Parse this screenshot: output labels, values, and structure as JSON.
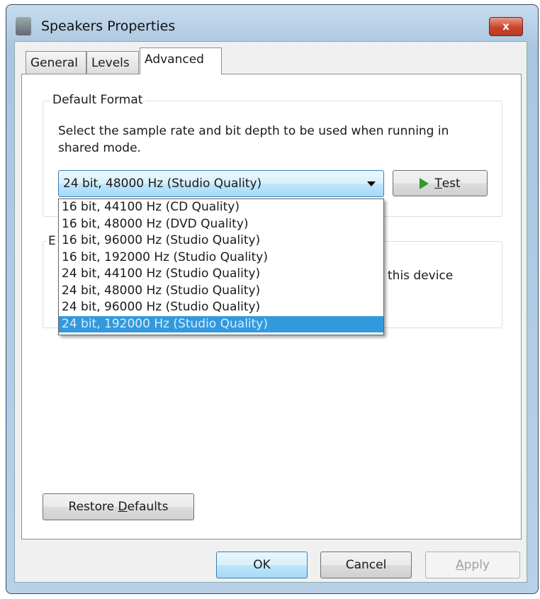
{
  "window": {
    "title": "Speakers Properties",
    "close_label": "x"
  },
  "tabs": [
    {
      "label": "General"
    },
    {
      "label": "Levels"
    },
    {
      "label": "Advanced"
    }
  ],
  "default_format": {
    "label": "Default Format",
    "description": "Select the sample rate and bit depth to be used when running in shared mode.",
    "selected": "24 bit, 48000 Hz (Studio Quality)",
    "options": [
      "16 bit, 44100 Hz (CD Quality)",
      "16 bit, 48000 Hz (DVD Quality)",
      "16 bit, 96000 Hz (Studio Quality)",
      "16 bit, 192000 Hz (Studio Quality)",
      "24 bit, 44100 Hz (Studio Quality)",
      "24 bit, 48000 Hz (Studio Quality)",
      "24 bit, 96000 Hz (Studio Quality)",
      "24 bit, 192000 Hz (Studio Quality)"
    ],
    "highlighted_index": 7,
    "test_label_prefix": "T",
    "test_label_rest": "est"
  },
  "exclusive": {
    "label_fragment": "E",
    "text_fragment": "this device"
  },
  "restore": {
    "before": "Restore ",
    "mnemonic": "D",
    "after": "efaults"
  },
  "footer": {
    "ok": "OK",
    "cancel": "Cancel",
    "apply_mnemonic": "A",
    "apply_rest": "pply"
  }
}
